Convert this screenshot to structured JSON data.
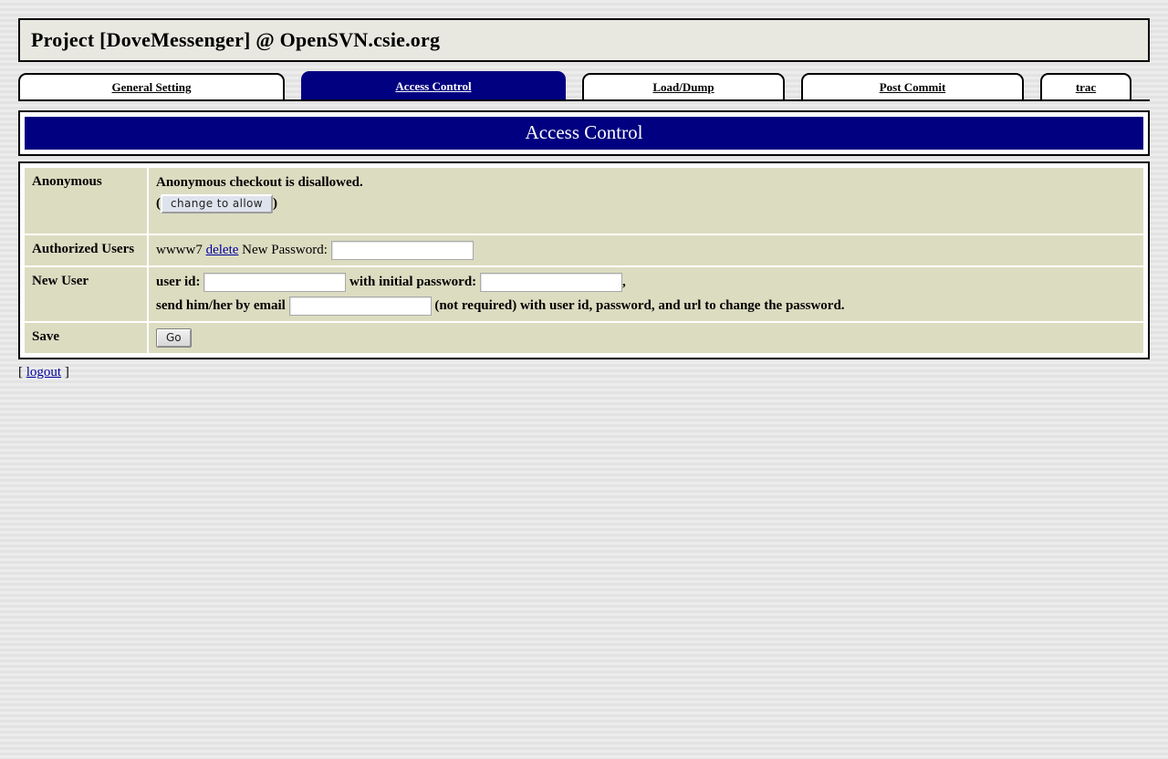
{
  "header": {
    "title": "Project [DoveMessenger] @ OpenSVN.csie.org"
  },
  "tabs": [
    {
      "label": "General Setting",
      "active": false
    },
    {
      "label": "Access Control",
      "active": true
    },
    {
      "label": "Load/Dump",
      "active": false
    },
    {
      "label": "Post Commit",
      "active": false
    },
    {
      "label": "trac",
      "active": false
    }
  ],
  "banner": {
    "title": "Access Control"
  },
  "rows": {
    "anonymous": {
      "label": "Anonymous",
      "status": "Anonymous checkout is disallowed.",
      "paren_open": "(",
      "paren_close": ")",
      "toggle_button": "change to allow"
    },
    "authorized_users": {
      "label": "Authorized Users",
      "user": "wwww7",
      "delete_link": "delete",
      "new_password_label": "New Password:",
      "new_password_value": ""
    },
    "new_user": {
      "label": "New User",
      "user_id_label": "user id:",
      "user_id_value": "",
      "initial_password_label": "with initial password:",
      "initial_password_value": "",
      "comma": ",",
      "email_label": "send him/her by email",
      "email_value": "",
      "email_note": "(not required) with user id, password, and url to change the password."
    },
    "save": {
      "label": "Save",
      "go_button": "Go"
    }
  },
  "footer": {
    "bracket_open": "[",
    "logout_link": "logout",
    "bracket_close": "]"
  },
  "colors": {
    "navy": "#000080",
    "table_cell": "#dcdcc1",
    "title_bar": "#e8e8e0",
    "link": "#0000a0",
    "page_background": "#eaeaea"
  }
}
